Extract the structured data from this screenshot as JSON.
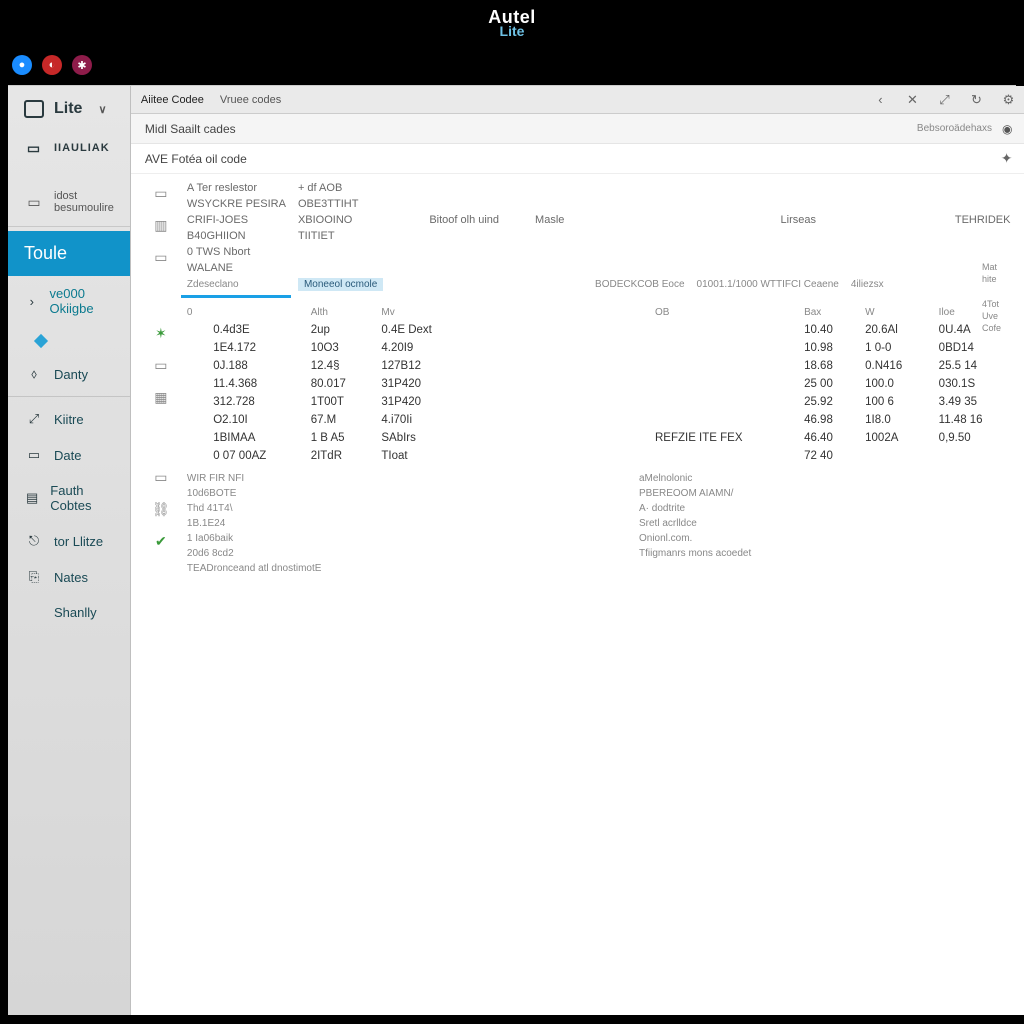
{
  "brand": {
    "line1": "Autel",
    "line2": "Lite"
  },
  "sidebar": {
    "header": "Lite",
    "items": [
      {
        "label": "IIAULIAK"
      },
      {
        "label": "idost besumoulire"
      }
    ],
    "active": "Toule",
    "nav": [
      {
        "label": "ve000 Okiigbe",
        "icon": "›"
      },
      {
        "label": "Danty",
        "icon": "⬨"
      },
      {
        "label": "Kiitre",
        "icon": "⤢"
      },
      {
        "label": "Date",
        "icon": "▭"
      },
      {
        "label": "Fauth Cobtes",
        "icon": "▤"
      },
      {
        "label": "tor Llitze",
        "icon": "⎋"
      },
      {
        "label": "Nates",
        "icon": "⎘"
      },
      {
        "label": "Shanlly",
        "icon": ""
      }
    ]
  },
  "tabs": {
    "t1": "Aiitee Codee",
    "t2": "Vruee codes"
  },
  "subheader": {
    "left": "Midl Saailt cades",
    "right": "Bebsoroädehaxs"
  },
  "titlerow": {
    "left": "AVE Fotéa oil  code"
  },
  "rightchip": [
    "Mat",
    "hite",
    "4Tot",
    "Uve",
    "Cofe"
  ],
  "topblock": {
    "rows": [
      [
        "A Ter reslestor",
        "+ df AOB",
        "",
        "",
        ""
      ],
      [
        "WSYCKRE PESIRA",
        "OBE3TTIHT",
        "",
        "",
        ""
      ],
      [
        "CRIFI-JOES",
        "XBIOOINO",
        "Bitoof olh uind",
        "Masle",
        "Lirseas",
        "TEHRIDEK"
      ],
      [
        "B40GHIION",
        "TIITIET",
        "",
        "",
        ""
      ],
      [
        "0 TWS Nbort",
        "",
        "",
        "",
        ""
      ],
      [
        "WALANE",
        "",
        "",
        "",
        ""
      ]
    ],
    "sectionNote": "Zdeseclano",
    "sectionPill": "Moneeol ocmole",
    "sectionRight": [
      "BODECKCOB Eoce",
      "01001.1/1000  WTTIFCI Ceaene",
      "4iliezsx"
    ]
  },
  "numtable": {
    "headers": [
      "0",
      "",
      "Alth",
      "Mv",
      "",
      "OB",
      "Bax",
      "W",
      "Iloe"
    ],
    "rows": [
      [
        "",
        "0.4d3E",
        "2up",
        "0.4E Dext",
        "",
        "",
        "10.40",
        "20.6Al",
        "0U.4A"
      ],
      [
        "",
        "1E4.172",
        "10O3",
        "4.20I9",
        "",
        "",
        "10.98",
        "1 0-0",
        "0BD14"
      ],
      [
        "",
        "0J.188",
        "12.4§",
        "127B12",
        "",
        "",
        "18.68",
        "0.N416",
        "25.5 14"
      ],
      [
        "",
        "11.4.368",
        "80.017",
        "31P420",
        "",
        "",
        "25 00",
        "100.0",
        "030.1S"
      ],
      [
        "",
        "312.728",
        "1T00T",
        "31P420",
        "",
        "",
        "25.92",
        "100  6",
        "3.49 35"
      ],
      [
        "",
        "O2.10I",
        "67.M",
        "4.i70Ii",
        "",
        "",
        "46.98",
        "1I8.0",
        "11.48 16"
      ],
      [
        "",
        "1BIMAA",
        "1 B A5",
        "SAbIrs",
        "",
        "REFZIE ITE FEX",
        "46.40",
        "1002A",
        "0,9.50"
      ],
      [
        "",
        "0 07 00AZ",
        "2ITdR",
        "TIoat",
        "",
        "",
        "72 40",
        "",
        ""
      ]
    ]
  },
  "bottomlist": [
    [
      "WIR FIR NFI",
      "aMelnolonic"
    ],
    [
      "10d6BOTE",
      "PBEREOOM AIAMN/"
    ],
    [
      "Thd 41T4\\",
      "A· dodtrite"
    ],
    [
      "1B.1E24",
      "Sretl acrlldce"
    ],
    [
      "1 Ia06baik",
      "Onionl.com."
    ],
    [
      "20d6 8cd2",
      "Tfiigmanrs mons acoedet"
    ],
    [
      "TEADronceand atl dnostimotE",
      ""
    ]
  ]
}
